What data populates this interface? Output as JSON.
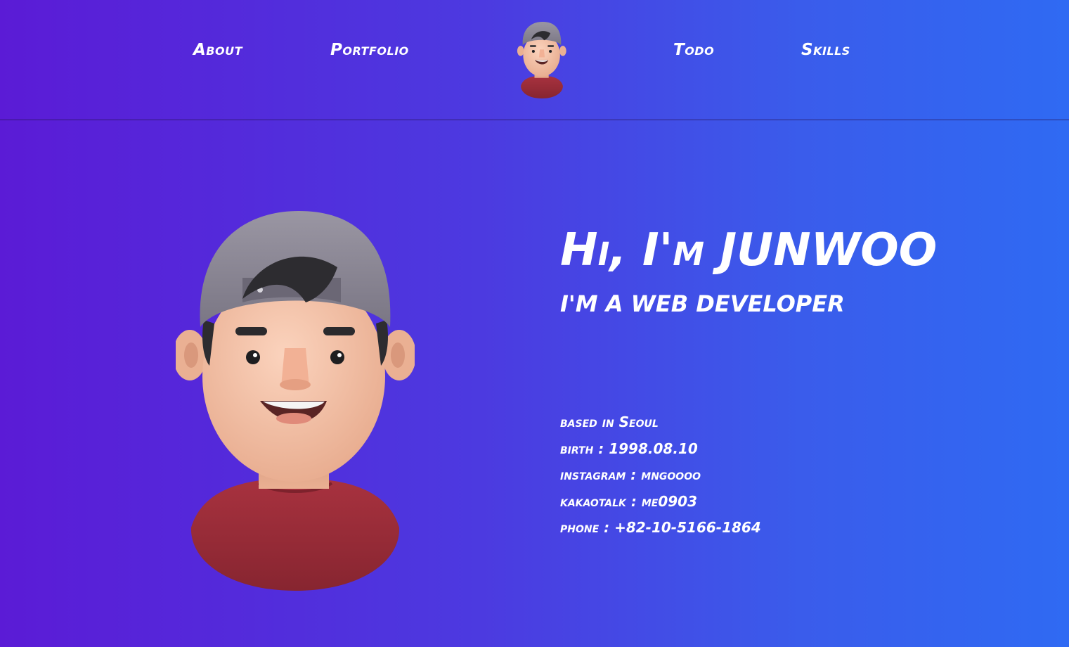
{
  "nav": {
    "about": "About",
    "portfolio": "Portfolio",
    "todo": "Todo",
    "skills": "Skills"
  },
  "hero": {
    "title": "Hi, I'm JUNWOO",
    "subtitle": "I'M A WEB DEVELOPER"
  },
  "info": {
    "based": "based in Seoul",
    "birth": "birth : 1998.08.10",
    "instagram": "instagram : mngoooo",
    "kakaotalk": "kakaotalk : me0903",
    "phone": "phone : +82-10-5166-1864"
  },
  "colors": {
    "gradient_start": "#5b1bd6",
    "gradient_end": "#2f6af3",
    "text": "#ffffff",
    "shirt": "#9b2f3b",
    "cap": "#8e8a97",
    "skin": "#f0b89a"
  }
}
